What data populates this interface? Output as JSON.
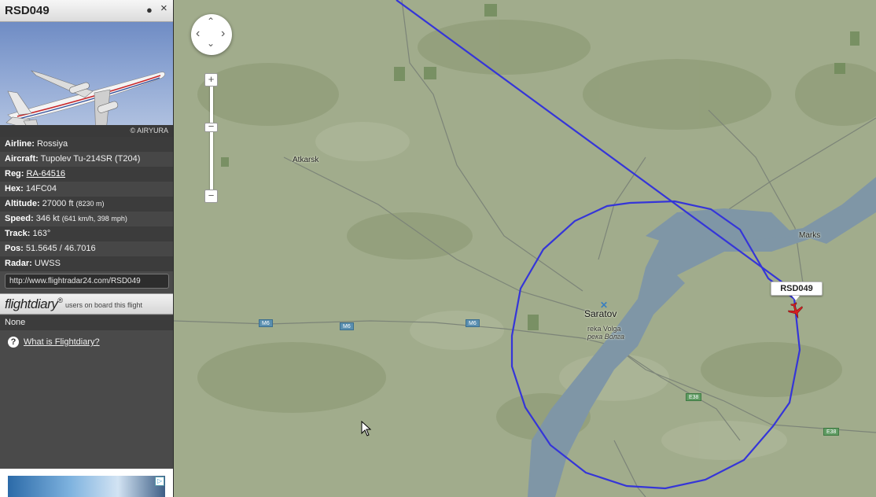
{
  "panel": {
    "callsign": "RSD049",
    "pin_icon": "●",
    "close_icon": "×",
    "photo_credit": "© AIRYURA",
    "fields": [
      {
        "label": "Airline:",
        "value": "Rossiya"
      },
      {
        "label": "Aircraft:",
        "value": "Tupolev Tu-214SR (T204)"
      },
      {
        "label": "Reg:",
        "value": "RA-64516"
      },
      {
        "label": "Hex:",
        "value": "14FC04"
      },
      {
        "label": "Altitude:",
        "value": "27000 ft",
        "extra": "(8230 m)"
      },
      {
        "label": "Speed:",
        "value": "346 kt",
        "extra": "(641 km/h, 398 mph)"
      },
      {
        "label": "Track:",
        "value": "163°"
      },
      {
        "label": "Pos:",
        "value": "51.5645 / 46.7016"
      },
      {
        "label": "Radar:",
        "value": "UWSS"
      }
    ],
    "flight_url": "http://www.flightradar24.com/RSD049",
    "flightdiary_logo": "flightdiary",
    "flightdiary_sup": "®",
    "flightdiary_text": "users on board this flight",
    "passengers": "None",
    "help_link": "What is Flightdiary?"
  },
  "map": {
    "places": {
      "atkarsk": "Atkarsk",
      "saratov": "Saratov",
      "river_latin": "reka Volga",
      "river_cyrillic": "река Волга",
      "marks": "Marks"
    },
    "roads": {
      "m6_a": "M6",
      "m6_b": "M6",
      "m6_c": "M6",
      "e38_a": "E38",
      "e38_b": "E38"
    },
    "flight_label": "RSD049",
    "track_color": "#3535d8",
    "plane_color": "#d62020"
  },
  "controls": {
    "pan_up": "⌃",
    "pan_down": "⌄",
    "pan_left": "‹",
    "pan_right": "›",
    "zoom_in": "+",
    "zoom_out": "−"
  }
}
